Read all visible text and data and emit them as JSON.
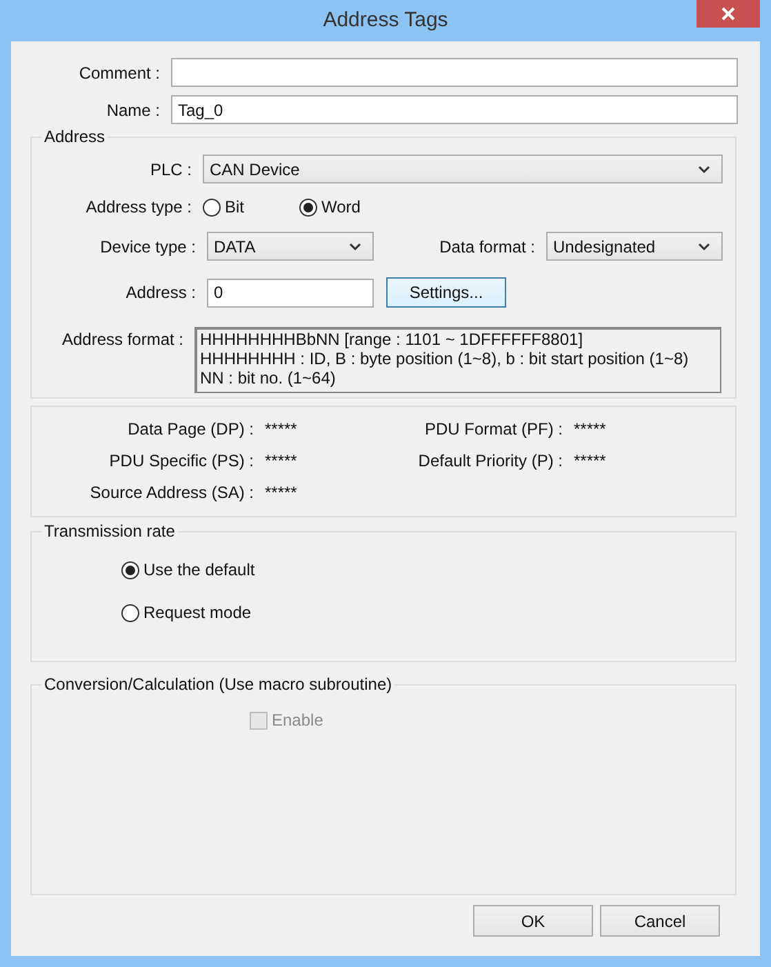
{
  "window": {
    "title": "Address Tags"
  },
  "comment": {
    "label": "Comment :"
  },
  "name": {
    "label": "Name :",
    "value": "Tag_0"
  },
  "address_group": {
    "title": "Address",
    "plc": {
      "label": "PLC :",
      "value": "CAN Device"
    },
    "address_type": {
      "label": "Address type :",
      "options": [
        {
          "label": "Bit",
          "selected": false
        },
        {
          "label": "Word",
          "selected": true
        }
      ]
    },
    "device_type": {
      "label": "Device type :",
      "value": "DATA"
    },
    "data_format": {
      "label": "Data format :",
      "value": "Undesignated"
    },
    "address": {
      "label": "Address :",
      "value": "0"
    },
    "settings_button": "Settings...",
    "address_format": {
      "label": "Address format :",
      "lines": [
        "HHHHHHHHBbNN [range : 1101 ~ 1DFFFFFF8801]",
        "HHHHHHHH : ID, B : byte position (1~8), b : bit start position (1~8)",
        "NN : bit no. (1~64)"
      ]
    }
  },
  "pgn_fields": [
    {
      "label": "Data Page (DP) :",
      "value": "*****"
    },
    {
      "label": "PDU Format (PF) :",
      "value": "*****"
    },
    {
      "label": "PDU Specific (PS) :",
      "value": "*****"
    },
    {
      "label": "Default Priority (P) :",
      "value": "*****"
    },
    {
      "label": "Source Address (SA) :",
      "value": "*****"
    }
  ],
  "transmission_rate": {
    "title": "Transmission rate",
    "options": [
      {
        "label": "Use the default",
        "selected": true
      },
      {
        "label": "Request mode",
        "selected": false
      }
    ]
  },
  "conversion": {
    "title": "Conversion/Calculation (Use macro subroutine)",
    "enable": {
      "label": "Enable",
      "checked": false,
      "disabled": true
    }
  },
  "buttons": [
    "OK",
    "Cancel"
  ]
}
